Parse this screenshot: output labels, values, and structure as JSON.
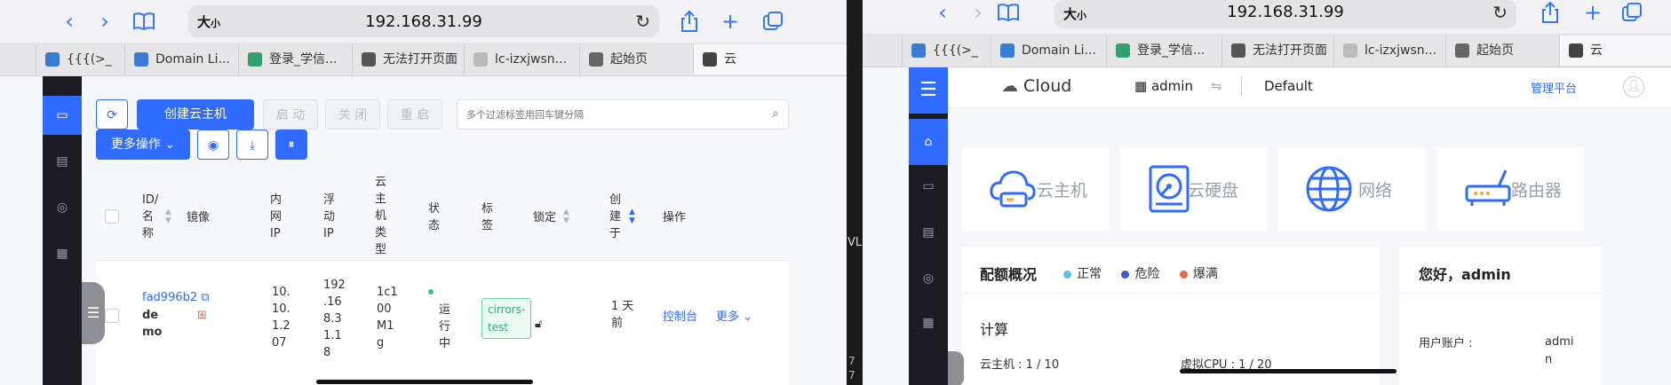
{
  "left": {
    "browser": {
      "reader_label": "大",
      "reader_small": "小",
      "url": "192.168.31.99",
      "tabs": [
        {
          "label": "{{{(>_",
          "icon_color": "#3a7bd5"
        },
        {
          "label": "Domain Li...",
          "icon_color": "#3a7bd5"
        },
        {
          "label": "登录_学信...",
          "icon_color": "#33a06f"
        },
        {
          "label": "无法打开页面",
          "icon_color": "#555555"
        },
        {
          "label": "lc-izxjwsn...",
          "icon_color": "#bbbbbb"
        },
        {
          "label": "起始页",
          "icon_color": "#666666"
        },
        {
          "label": "云",
          "icon_color": "#444444"
        }
      ]
    },
    "toolbar": {
      "create_label": "创建云主机",
      "start_label": "启 动",
      "stop_label": "关 闭",
      "restart_label": "重 启",
      "more_label": "更多操作",
      "search_placeholder": "多个过滤标签用回车键分隔"
    },
    "table": {
      "headers": {
        "id_name": [
          "ID/",
          "名",
          "称"
        ],
        "image": "镜像",
        "internal_ip": [
          "内",
          "网",
          "IP"
        ],
        "float_ip": [
          "浮",
          "动",
          "IP"
        ],
        "type": [
          "云",
          "主",
          "机",
          "类",
          "型"
        ],
        "status": [
          "状",
          "态"
        ],
        "tag": [
          "标",
          "签"
        ],
        "lock": "锁定",
        "created": [
          "创",
          "建",
          "于"
        ],
        "action": "操作"
      },
      "row": {
        "id": "fad996b2",
        "name": [
          "de",
          "mo"
        ],
        "internal_ip": [
          "10.",
          "10.",
          "1.2",
          "07"
        ],
        "float_ip": [
          "192",
          ".16",
          "8.3",
          "1.1",
          "8"
        ],
        "type": [
          "1c1",
          "00",
          "M1",
          "g"
        ],
        "status": [
          "运",
          "行",
          "中"
        ],
        "tag": [
          "cirrors-",
          "test"
        ],
        "created": [
          "1 天",
          "前"
        ],
        "console_label": "控制台",
        "more_label": "更多"
      }
    }
  },
  "divider": {
    "text": "VL",
    "nums": [
      "7",
      "7"
    ]
  },
  "right": {
    "browser": {
      "reader_label": "大",
      "reader_small": "小",
      "url": "192.168.31.99",
      "tabs": [
        {
          "label": "{{{(>_",
          "icon_color": "#3a7bd5"
        },
        {
          "label": "Domain Li...",
          "icon_color": "#3a7bd5"
        },
        {
          "label": "登录_学信...",
          "icon_color": "#33a06f"
        },
        {
          "label": "无法打开页面",
          "icon_color": "#555555"
        },
        {
          "label": "lc-izxjwsn...",
          "icon_color": "#bbbbbb"
        },
        {
          "label": "起始页",
          "icon_color": "#666666"
        },
        {
          "label": "云",
          "icon_color": "#444444"
        }
      ]
    },
    "header": {
      "logo_text": "Cloud",
      "user": "admin",
      "project": "Default",
      "admin_link": "管理平台"
    },
    "tiles": [
      "云主机",
      "云硬盘",
      "网络",
      "路由器"
    ],
    "quota": {
      "title": "配额概况",
      "legend": [
        {
          "label": "正常",
          "color": "#5bc0eb"
        },
        {
          "label": "危险",
          "color": "#3b5bdb"
        },
        {
          "label": "爆满",
          "color": "#e06c4f"
        }
      ],
      "section": "计算",
      "instances": "云主机 : 1 / 10",
      "vcpu": "虚拟CPU : 1 / 20"
    },
    "welcome": {
      "title": "您好，admin",
      "account_label": "用户账户 :",
      "account_value": [
        "admi",
        "n"
      ]
    }
  },
  "colors": {
    "primary": "#2f6bff",
    "sidebar": "#1c1c22",
    "safari_blue": "#3478f6"
  }
}
